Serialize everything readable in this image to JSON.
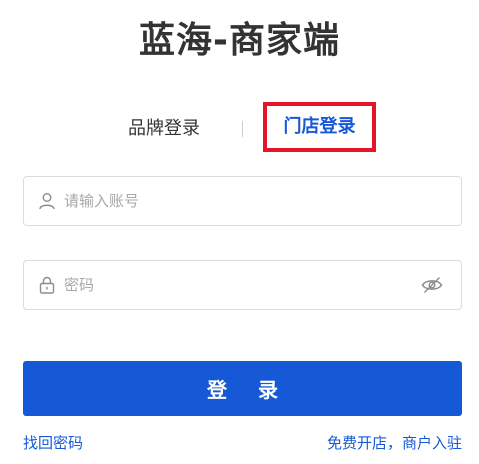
{
  "app": {
    "title": "蓝海-商家端"
  },
  "tabs": {
    "brand_label": "品牌登录",
    "store_label": "门店登录",
    "active": "store"
  },
  "form": {
    "account_placeholder": "请输入账号",
    "account_value": "",
    "password_placeholder": "密码",
    "password_value": ""
  },
  "actions": {
    "login_label": "登 录",
    "forgot_label": "找回密码",
    "register_label": "免费开店，商户入驻"
  },
  "icons": {
    "account": "user-icon",
    "password": "lock-icon",
    "toggle_visibility": "eye-off-icon"
  },
  "colors": {
    "accent": "#1659d6",
    "highlight_border": "#e6142a"
  }
}
